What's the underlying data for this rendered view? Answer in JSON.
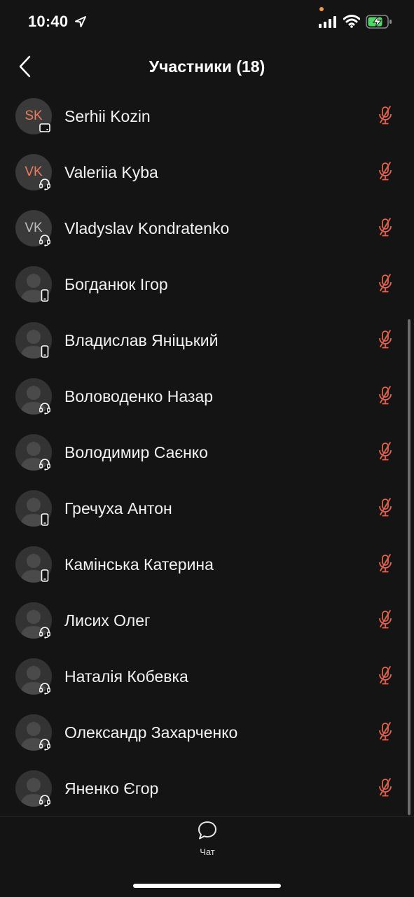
{
  "status_bar": {
    "time": "10:40",
    "icons": [
      "location-arrow-icon",
      "signal-icon",
      "wifi-icon",
      "battery-charging-icon"
    ]
  },
  "header": {
    "title": "Участники (18)",
    "back_icon": "chevron-left-icon"
  },
  "colors": {
    "background": "#141414",
    "muted_mic": "#e8604c",
    "initials_orange": "#f07a5a",
    "avatar_bg": "#3a3a3a"
  },
  "participants": [
    {
      "name": "Serhii Kozin",
      "initials": "SK",
      "initials_color": "#f07a5a",
      "device": "tablet-icon",
      "mic": "mic-muted-icon"
    },
    {
      "name": "Valeriia Kyba",
      "initials": "VK",
      "initials_color": "#f07a5a",
      "device": "headset-icon",
      "mic": "mic-muted-icon"
    },
    {
      "name": "Vladyslav Kondratenko",
      "initials": "VK",
      "initials_color": "#bdbdbd",
      "device": "headset-icon",
      "mic": "mic-muted-icon"
    },
    {
      "name": "Богданюк Ігор",
      "initials": "",
      "device": "phone-icon",
      "mic": "mic-muted-icon"
    },
    {
      "name": "Владислав Яніцький",
      "initials": "",
      "device": "phone-icon",
      "mic": "mic-muted-icon"
    },
    {
      "name": "Воловоденко Назар",
      "initials": "",
      "device": "headset-icon",
      "mic": "mic-muted-icon"
    },
    {
      "name": "Володимир Саєнко",
      "initials": "",
      "device": "headset-icon",
      "mic": "mic-muted-icon"
    },
    {
      "name": "Гречуха Антон",
      "initials": "",
      "device": "phone-icon",
      "mic": "mic-muted-icon"
    },
    {
      "name": "Камінська Катерина",
      "initials": "",
      "device": "phone-icon",
      "mic": "mic-muted-icon"
    },
    {
      "name": "Лисих Олег",
      "initials": "",
      "device": "headset-icon",
      "mic": "mic-muted-icon"
    },
    {
      "name": "Наталія Кобевка",
      "initials": "",
      "device": "headset-icon",
      "mic": "mic-muted-icon"
    },
    {
      "name": "Олександр Захарченко",
      "initials": "",
      "device": "headset-icon",
      "mic": "mic-muted-icon"
    },
    {
      "name": "Яненко Єгор",
      "initials": "",
      "device": "headset-icon",
      "mic": "mic-muted-icon"
    }
  ],
  "bottom_bar": {
    "chat_label": "Чат",
    "chat_icon": "chat-bubble-icon"
  }
}
